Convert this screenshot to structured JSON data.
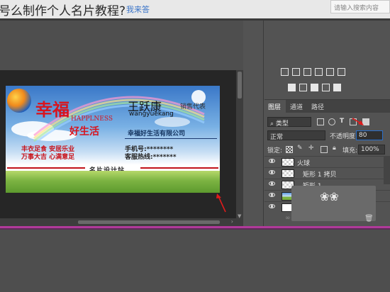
{
  "page": {
    "title_text": "号么制作个人名片教程?",
    "link_text": "我来答",
    "search_placeholder": "请输入搜索内容"
  },
  "card": {
    "name": "王跃康",
    "job_title": "销售代表",
    "pinyin": "wangyuekang",
    "company": "幸福好生活有限公司",
    "phone": "手机号:********",
    "hotline": "客服热线:*******",
    "footer": "名片设计站",
    "logo_big": "幸福",
    "logo_english": "HAPPLNESS",
    "logo_tagline": "好生活",
    "slogan_line1": "丰衣足食  安居乐业",
    "slogan_line2": "万事大吉  心满意足"
  },
  "layers_panel": {
    "tabs": [
      "图层",
      "通道",
      "路径"
    ],
    "filter_kind": "类型",
    "blend_mode": "正常",
    "opacity_label": "不透明度:",
    "opacity_value": "80",
    "lock_label": "锁定:",
    "fill_label": "填充:",
    "fill_value": "100%",
    "layers": [
      {
        "name": "火球"
      },
      {
        "name": "矩形 1 拷贝"
      },
      {
        "name": "矩形 1"
      },
      {
        "name": "图层"
      },
      {
        "name": ""
      }
    ]
  },
  "colors": {
    "annotation_arrow": "#e01b1b",
    "accent_line": "#b03a9a"
  }
}
